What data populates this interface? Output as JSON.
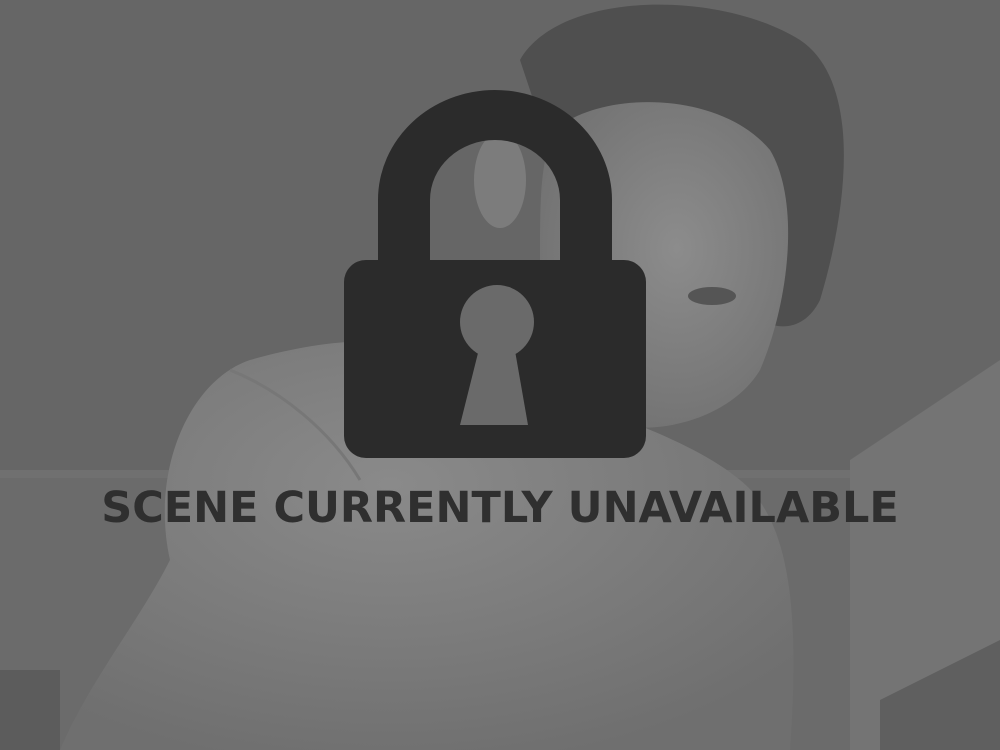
{
  "scene": {
    "status_message": "SCENE CURRENTLY UNAVAILABLE",
    "icon": "padlock-icon",
    "locked": true
  },
  "colors": {
    "overlay_gray": "#6d6d6d",
    "lock_fill": "#2b2b2b",
    "text": "#2f2f2f"
  }
}
